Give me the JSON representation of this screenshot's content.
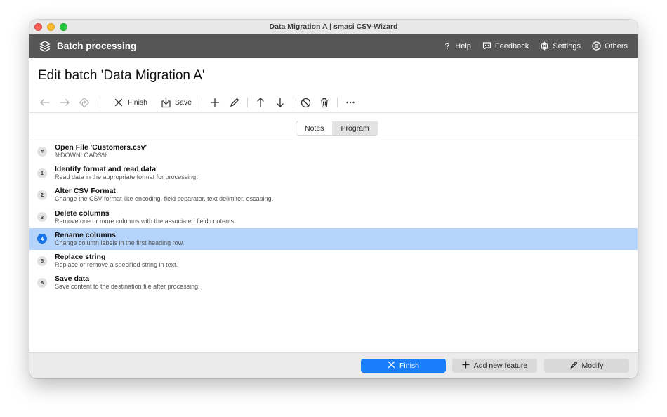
{
  "window": {
    "title": "Data Migration A  |  smasi CSV-Wizard"
  },
  "appbar": {
    "app_name": "Batch processing",
    "logo_icon": "layers-icon",
    "items": [
      {
        "label": "Help",
        "icon": "question-icon"
      },
      {
        "label": "Feedback",
        "icon": "speech-bubble-icon"
      },
      {
        "label": "Settings",
        "icon": "gear-icon"
      },
      {
        "label": "Others",
        "icon": "list-circle-icon"
      }
    ]
  },
  "page": {
    "title": "Edit batch 'Data Migration A'"
  },
  "toolbar": {
    "finish_label": "Finish",
    "save_label": "Save"
  },
  "segment": {
    "tabs": [
      "Notes",
      "Program"
    ],
    "active": "Program"
  },
  "steps": [
    {
      "badge": "#",
      "title": "Open File 'Customers.csv'",
      "desc": "%DOWNLOADS%",
      "selected": false
    },
    {
      "badge": "1",
      "title": "Identify format and read data",
      "desc": "Read data in the appropriate format for processing.",
      "selected": false
    },
    {
      "badge": "2",
      "title": "Alter CSV Format",
      "desc": "Change the CSV format like encoding, field separator, text delimiter, escaping.",
      "selected": false
    },
    {
      "badge": "3",
      "title": "Delete columns",
      "desc": "Remove one or more columns with the associated field contents.",
      "selected": false
    },
    {
      "badge": "4",
      "title": "Rename columns",
      "desc": "Change column labels in the first heading row.",
      "selected": true
    },
    {
      "badge": "5",
      "title": "Replace string",
      "desc": "Replace or remove a specified string in text.",
      "selected": false
    },
    {
      "badge": "6",
      "title": "Save data",
      "desc": "Save content to the destination file after processing.",
      "selected": false
    }
  ],
  "footer": {
    "finish_label": "Finish",
    "add_label": "Add new feature",
    "modify_label": "Modify"
  },
  "colors": {
    "appbar": "#565656",
    "selection": "#b5d4fb",
    "primary": "#1a7dfa"
  }
}
